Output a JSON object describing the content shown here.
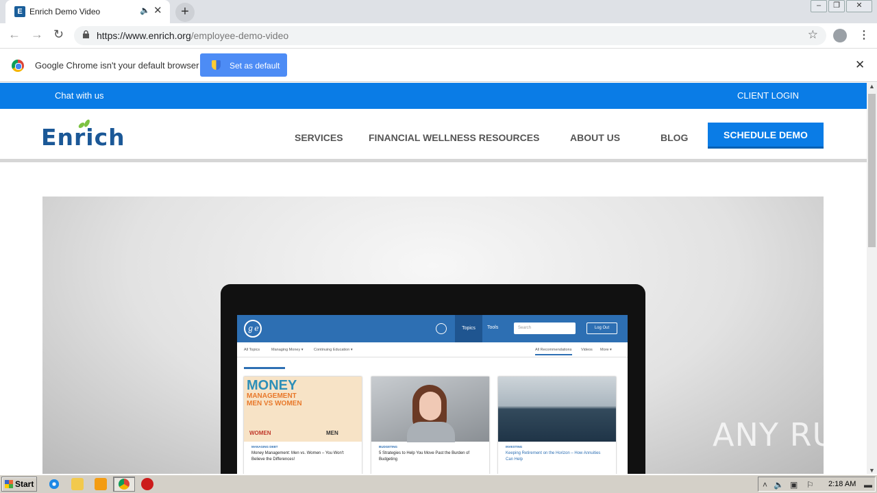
{
  "browser": {
    "tab_title": "Enrich Demo Video",
    "tab_favicon_letter": "E",
    "new_tab_label": "+",
    "url_host": "https://www.enrich.org",
    "url_path": "/employee-demo-video",
    "infobar_message": "Google Chrome isn't your default browser",
    "set_default_label": "Set as default"
  },
  "site": {
    "topbar": {
      "chat": "Chat with us",
      "login": "CLIENT LOGIN"
    },
    "logo": "Enrich",
    "nav": {
      "services": "SERVICES",
      "resources": "FINANCIAL WELLNESS RESOURCES",
      "about": "ABOUT US",
      "blog": "BLOG",
      "demo": "SCHEDULE DEMO"
    },
    "brand_color": "#0a7ce6"
  },
  "video_screen": {
    "topics": "Topics",
    "tools": "Tools",
    "search_placeholder": "Search",
    "logout": "Log Out",
    "subnav": [
      "All Topics",
      "Managing Money ▾",
      "Continuing Education ▾"
    ],
    "subnav_right": [
      "All Recommendations",
      "Videos",
      "More ▾"
    ],
    "cards": [
      {
        "category": "MANAGING DEBT",
        "title": "Money Management: Men vs. Women – You Won't Believe the Differences!",
        "image_title": "MONEY",
        "image_sub1": "MANAGEMENT",
        "image_sub2": "MEN VS WOMEN",
        "women": "WOMEN",
        "men": "MEN"
      },
      {
        "category": "BUDGETING",
        "title": "5 Strategies to Help You Move Past the Burden of Budgeting"
      },
      {
        "category": "INVESTING",
        "title": "Keeping Retirement on the Horizon – How Annuities Can Help"
      }
    ]
  },
  "watermark": "ANY RUN",
  "taskbar": {
    "start": "Start",
    "clock": "2:18 AM"
  }
}
